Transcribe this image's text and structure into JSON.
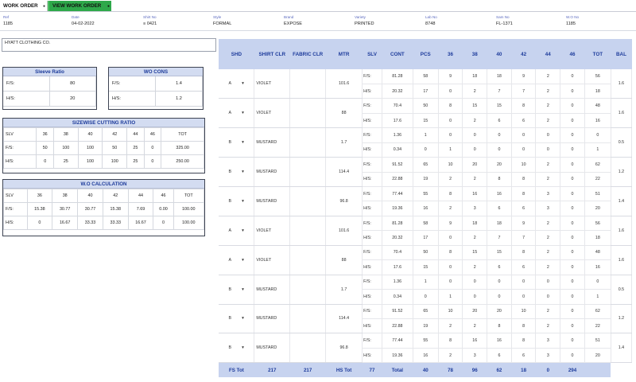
{
  "tabs": [
    {
      "label": "WORK ORDER",
      "dot": "●"
    },
    {
      "label": "VIEW WORK ORDER",
      "dot": "●"
    }
  ],
  "info": [
    {
      "label": "Ref",
      "value": "1185"
    },
    {
      "label": "Date",
      "value": "04-02-2022"
    },
    {
      "label": "Shirt No",
      "value": "≡ 0421"
    },
    {
      "label": "Style",
      "value": "FORMAL"
    },
    {
      "label": "Brand",
      "value": "EXPOSE"
    },
    {
      "label": "Variety",
      "value": "PRINTED"
    },
    {
      "label": "Lab No",
      "value": "8748"
    },
    {
      "label": "Sam No",
      "value": "FL-1371"
    },
    {
      "label": "W.O No",
      "value": "1185"
    }
  ],
  "buyer": "HYATT CLOTHING CO.",
  "sleeve_ratio": {
    "title": "Sleeve Ratio",
    "rows": [
      {
        "k": "F/S:",
        "v": "80"
      },
      {
        "k": "H/S:",
        "v": "20"
      }
    ]
  },
  "wo_cons": {
    "title": "WO CONS",
    "rows": [
      {
        "k": "F/S:",
        "v": "1.4"
      },
      {
        "k": "H/S:",
        "v": "1.2"
      }
    ]
  },
  "sizewise": {
    "title": "SIZEWISE CUTTING RATIO",
    "header": [
      "SLV",
      "36",
      "38",
      "40",
      "42",
      "44",
      "46",
      "TOT"
    ],
    "rows": [
      [
        "F/S:",
        "50",
        "100",
        "100",
        "50",
        "25",
        "0",
        "325.00"
      ],
      [
        "H/S:",
        "0",
        "25",
        "100",
        "100",
        "25",
        "0",
        "250.00"
      ]
    ]
  },
  "wo_calc": {
    "title": "W.O CALCULATION",
    "header": [
      "SLV",
      "36",
      "38",
      "40",
      "42",
      "44",
      "46",
      "TOT"
    ],
    "rows": [
      [
        "F/S:",
        "15.38",
        "30.77",
        "30.77",
        "15.38",
        "7.69",
        "0.00",
        "100.00"
      ],
      [
        "H/S:",
        "0",
        "16.67",
        "33.33",
        "33.33",
        "16.67",
        "0",
        "100.00"
      ]
    ]
  },
  "main": {
    "headers": [
      "SHD",
      "SHIRT CLR",
      "FABRIC CLR",
      "MTR",
      "SLV",
      "CONT",
      "PCS",
      "36",
      "38",
      "40",
      "42",
      "44",
      "46",
      "TOT",
      "BAL"
    ],
    "groups": [
      {
        "shd": "A",
        "clr": "VIOLET",
        "mtr": "101.6",
        "bal": "1.6",
        "rows": [
          [
            "F/S:",
            "81.28",
            "58",
            "9",
            "18",
            "18",
            "9",
            "2",
            "0",
            "56"
          ],
          [
            "H/S:",
            "20.32",
            "17",
            "0",
            "2",
            "7",
            "7",
            "2",
            "0",
            "18"
          ]
        ]
      },
      {
        "shd": "A",
        "clr": "VIOLET",
        "mtr": "88",
        "bal": "1.6",
        "rows": [
          [
            "F/S:",
            "70.4",
            "50",
            "8",
            "15",
            "15",
            "8",
            "2",
            "0",
            "48"
          ],
          [
            "H/S:",
            "17.6",
            "15",
            "0",
            "2",
            "6",
            "6",
            "2",
            "0",
            "16"
          ]
        ]
      },
      {
        "shd": "B",
        "clr": "MUSTARD",
        "mtr": "1.7",
        "bal": "0.5",
        "rows": [
          [
            "F/S:",
            "1.36",
            "1",
            "0",
            "0",
            "0",
            "0",
            "0",
            "0",
            "0"
          ],
          [
            "H/S:",
            "0.34",
            "0",
            "1",
            "0",
            "0",
            "0",
            "0",
            "0",
            "1"
          ]
        ]
      },
      {
        "shd": "B",
        "clr": "MUSTARD",
        "mtr": "114.4",
        "bal": "1.2",
        "rows": [
          [
            "F/S:",
            "91.52",
            "65",
            "10",
            "20",
            "20",
            "10",
            "2",
            "0",
            "62"
          ],
          [
            "H/S:",
            "22.88",
            "19",
            "2",
            "2",
            "8",
            "8",
            "2",
            "0",
            "22"
          ]
        ]
      },
      {
        "shd": "B",
        "clr": "MUSTARD",
        "mtr": "96.8",
        "bal": "1.4",
        "rows": [
          [
            "F/S:",
            "77.44",
            "55",
            "8",
            "16",
            "16",
            "8",
            "3",
            "0",
            "51"
          ],
          [
            "H/S:",
            "19.36",
            "16",
            "2",
            "3",
            "6",
            "6",
            "3",
            "0",
            "20"
          ]
        ]
      },
      {
        "shd": "A",
        "clr": "VIOLET",
        "mtr": "101.6",
        "bal": "1.6",
        "rows": [
          [
            "F/S:",
            "81.28",
            "58",
            "9",
            "18",
            "18",
            "9",
            "2",
            "0",
            "56"
          ],
          [
            "H/S:",
            "20.32",
            "17",
            "0",
            "2",
            "7",
            "7",
            "2",
            "0",
            "18"
          ]
        ]
      },
      {
        "shd": "A",
        "clr": "VIOLET",
        "mtr": "88",
        "bal": "1.6",
        "rows": [
          [
            "F/S:",
            "70.4",
            "50",
            "8",
            "15",
            "15",
            "8",
            "2",
            "0",
            "48"
          ],
          [
            "H/S:",
            "17.6",
            "15",
            "0",
            "2",
            "6",
            "6",
            "2",
            "0",
            "16"
          ]
        ]
      },
      {
        "shd": "B",
        "clr": "MUSTARD",
        "mtr": "1.7",
        "bal": "0.5",
        "rows": [
          [
            "F/S:",
            "1.36",
            "1",
            "0",
            "0",
            "0",
            "0",
            "0",
            "0",
            "0"
          ],
          [
            "H/S:",
            "0.34",
            "0",
            "1",
            "0",
            "0",
            "0",
            "0",
            "0",
            "1"
          ]
        ]
      },
      {
        "shd": "B",
        "clr": "MUSTARD",
        "mtr": "114.4",
        "bal": "1.2",
        "rows": [
          [
            "F/S:",
            "91.52",
            "65",
            "10",
            "20",
            "20",
            "10",
            "2",
            "0",
            "62"
          ],
          [
            "H/S:",
            "22.88",
            "19",
            "2",
            "2",
            "8",
            "8",
            "2",
            "0",
            "22"
          ]
        ]
      },
      {
        "shd": "B",
        "clr": "MUSTARD",
        "mtr": "96.8",
        "bal": "1.4",
        "rows": [
          [
            "F/S:",
            "77.44",
            "55",
            "8",
            "16",
            "16",
            "8",
            "3",
            "0",
            "51"
          ],
          [
            "H/S:",
            "19.36",
            "16",
            "2",
            "3",
            "6",
            "6",
            "3",
            "0",
            "20"
          ]
        ]
      }
    ],
    "footer": [
      "FS Tot",
      "217",
      "217",
      "HS Tot",
      "77",
      "Total",
      "40",
      "78",
      "96",
      "62",
      "18",
      "0",
      "294",
      ""
    ]
  },
  "colors": {
    "accent_green": "#2ea84a",
    "header_blue": "#c7d3ef",
    "header_text": "#1d3b9b"
  }
}
